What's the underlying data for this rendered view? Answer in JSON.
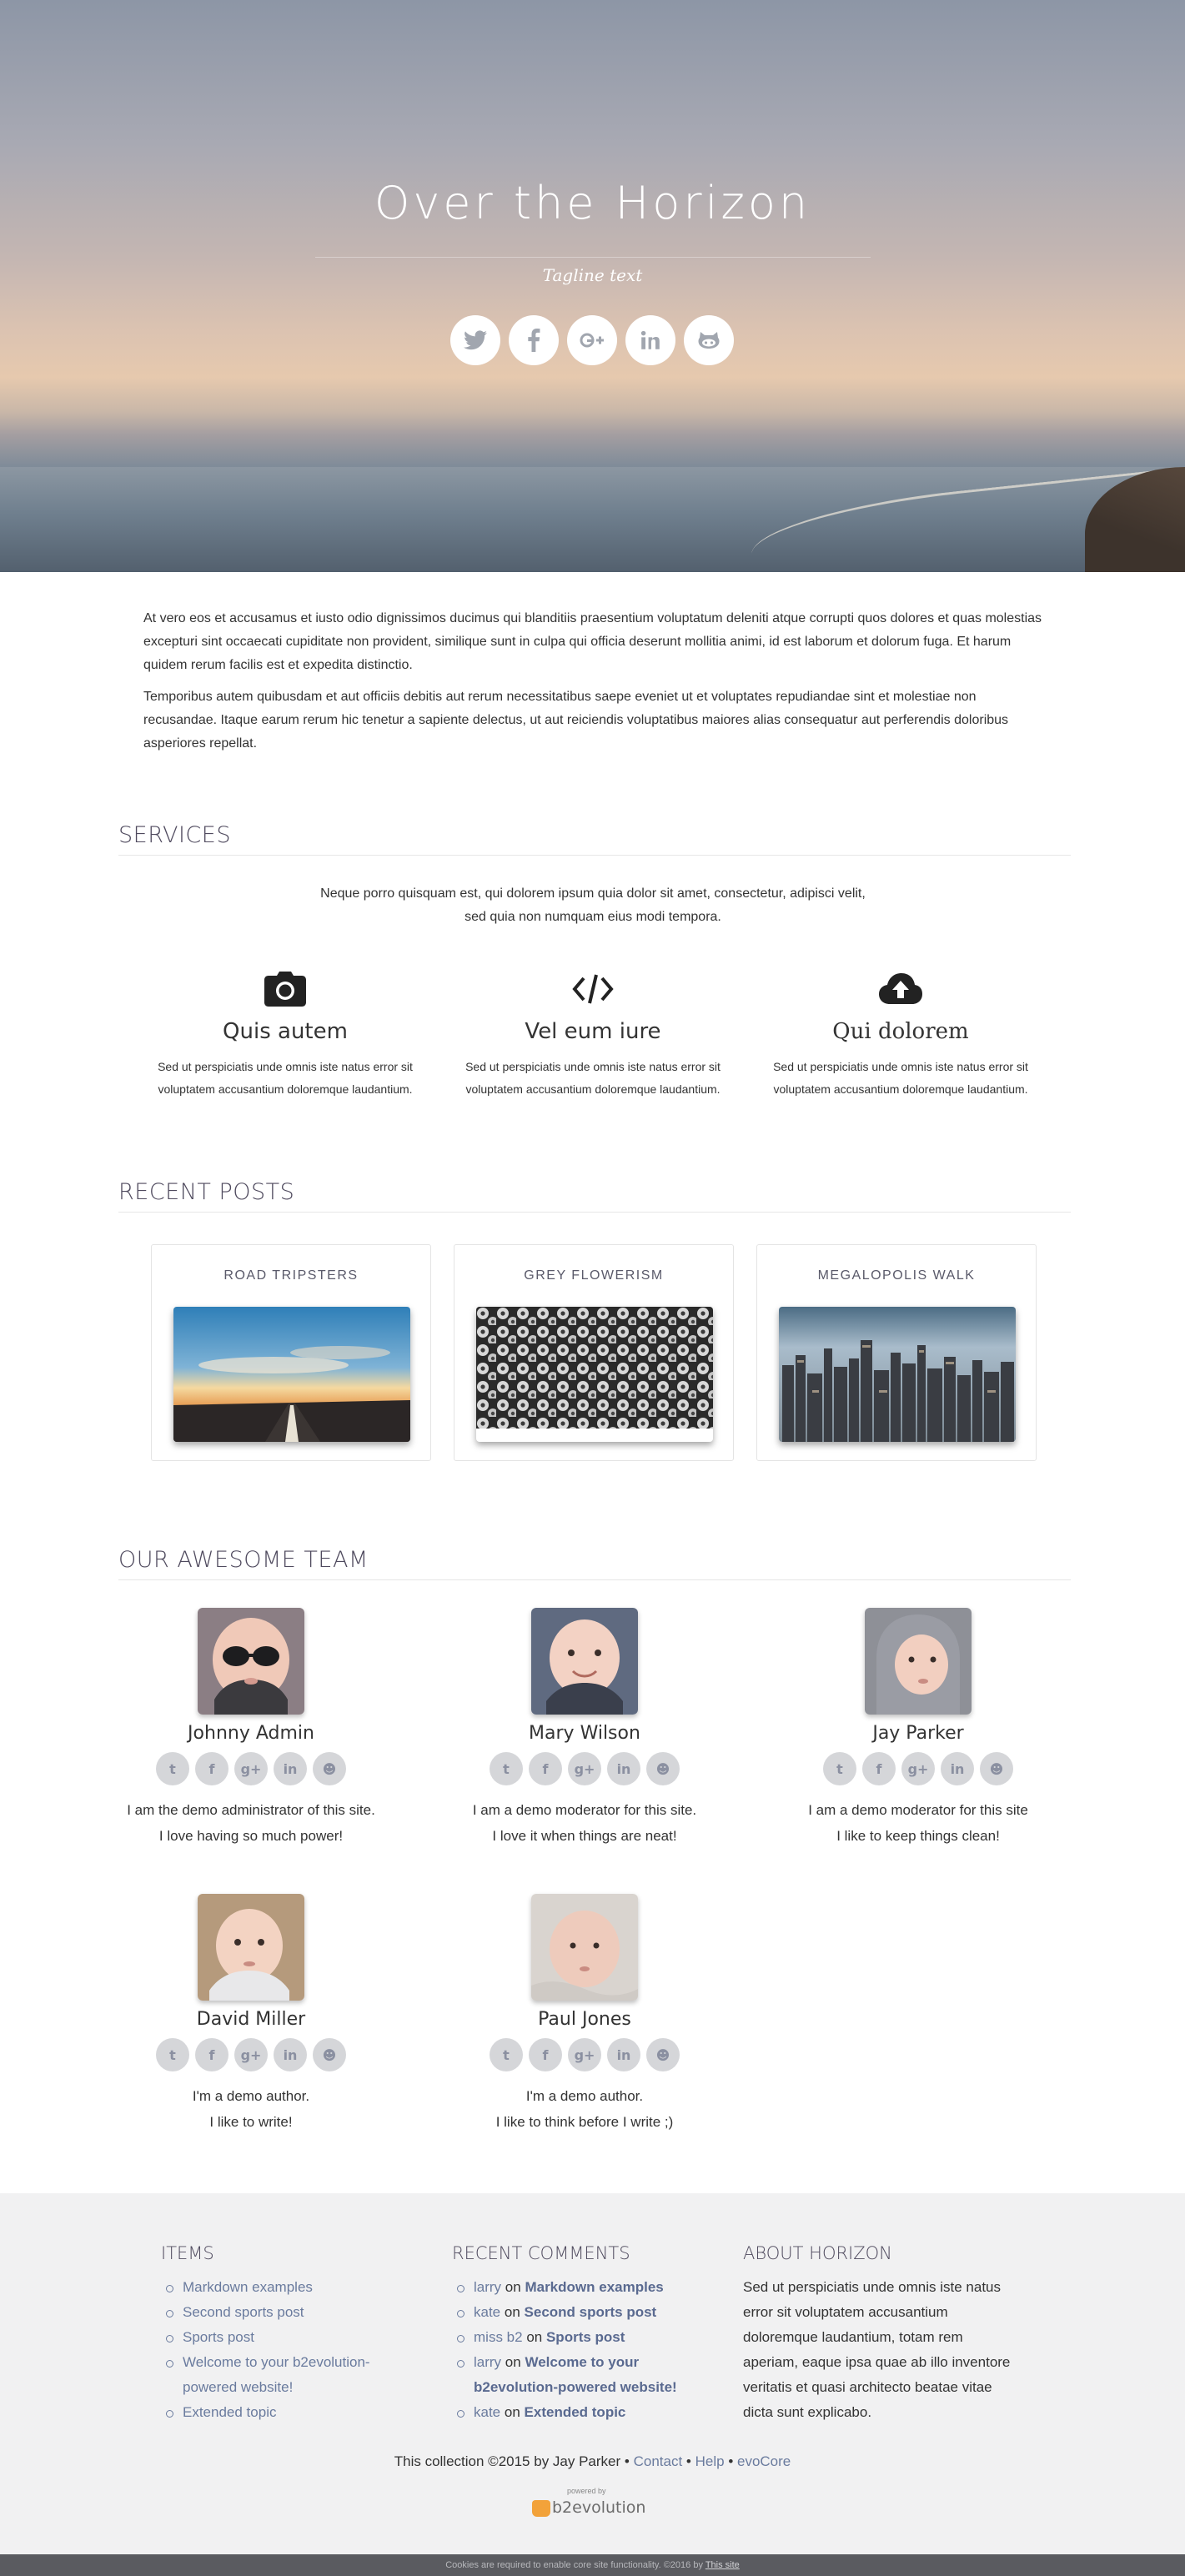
{
  "hero": {
    "title": "Over the Horizon",
    "tagline": "Tagline text",
    "social": [
      "twitter-icon",
      "facebook-icon",
      "google-plus-icon",
      "linkedin-icon",
      "github-icon"
    ]
  },
  "intro": {
    "p1": "At vero eos et accusamus et iusto odio dignissimos ducimus qui blanditiis praesentium voluptatum deleniti atque corrupti quos dolores et quas molestias excepturi sint occaecati cupiditate non provident, similique sunt in culpa qui officia deserunt mollitia animi, id est laborum et dolorum fuga. Et harum quidem rerum facilis est et expedita distinctio.",
    "p2": "Temporibus autem quibusdam et aut officiis debitis aut rerum necessitatibus saepe eveniet ut et voluptates repudiandae sint et molestiae non recusandae. Itaque earum rerum hic tenetur a sapiente delectus, ut aut reiciendis voluptatibus maiores alias consequatur aut perferendis doloribus asperiores repellat."
  },
  "services": {
    "heading": "SERVICES",
    "intro": "Neque porro quisquam est, qui dolorem ipsum quia dolor sit amet, consectetur, adipisci velit, sed quia non numquam eius modi tempora.",
    "items": [
      {
        "icon": "camera-icon",
        "title": "Quis autem",
        "desc": "Sed ut perspiciatis unde omnis iste natus error sit voluptatem accusantium doloremque laudantium."
      },
      {
        "icon": "code-icon",
        "title": "Vel eum iure",
        "desc": "Sed ut perspiciatis unde omnis iste natus error sit voluptatem accusantium doloremque laudantium."
      },
      {
        "icon": "cloud-upload-icon",
        "title": "Qui dolorem",
        "desc": "Sed ut perspiciatis unde omnis iste natus error sit voluptatem accusantium doloremque laudantium."
      }
    ]
  },
  "posts": {
    "heading": "RECENT POSTS",
    "items": [
      {
        "title": "ROAD TRIPSTERS"
      },
      {
        "title": "GREY FLOWERISM"
      },
      {
        "title": "MEGALOPOLIS WALK"
      }
    ]
  },
  "team": {
    "heading": "OUR AWESOME TEAM",
    "members": [
      {
        "name": "Johnny Admin",
        "bio1": "I am the demo administrator of this site.",
        "bio2": "I love having so much power!"
      },
      {
        "name": "Mary Wilson",
        "bio1": "I am a demo moderator for this site.",
        "bio2": "I love it when things are neat!"
      },
      {
        "name": "Jay Parker",
        "bio1": "I am a demo moderator for this site",
        "bio2": "I like to keep things clean!"
      },
      {
        "name": "David Miller",
        "bio1": "I'm a demo author.",
        "bio2": "I like to write!"
      },
      {
        "name": "Paul Jones",
        "bio1": "I'm a demo author.",
        "bio2": "I like to think before I write ;)"
      }
    ]
  },
  "footer": {
    "items_heading": "ITEMS",
    "items": [
      "Markdown examples",
      "Second sports post",
      "Sports post",
      "Welcome to your b2evolution-powered website!",
      "Extended topic"
    ],
    "comments_heading": "RECENT COMMENTS",
    "comments": [
      {
        "who": "larry",
        "on": "on",
        "what": "Markdown examples"
      },
      {
        "who": "kate",
        "on": "on",
        "what": "Second sports post"
      },
      {
        "who": "miss b2",
        "on": "on",
        "what": "Sports post"
      },
      {
        "who": "larry",
        "on": "on",
        "what": "Welcome to your b2evolution-powered website!"
      },
      {
        "who": "kate",
        "on": "on",
        "what": "Extended topic"
      }
    ],
    "about_heading": "ABOUT HORIZON",
    "about_text": "Sed ut perspiciatis unde omnis iste natus error sit voluptatem accusantium doloremque laudantium, totam rem aperiam, eaque ipsa quae ab illo inventore veritatis et quasi architecto beatae vitae dicta sunt explicabo.",
    "credit_prefix": "This collection ©2015 by Jay Parker",
    "sep": "•",
    "link_contact": "Contact",
    "link_help": "Help",
    "link_evocore": "evoCore",
    "powered_by": "powered by",
    "powered_logo": "b2evolution"
  },
  "cookie": {
    "text": "Cookies are required to enable core site functionality. ©2016 by",
    "link": "This site"
  },
  "colors": {
    "accent": "#6a7b9e",
    "heading": "#4f4a5e",
    "footer_bg": "#f1f1f2"
  }
}
